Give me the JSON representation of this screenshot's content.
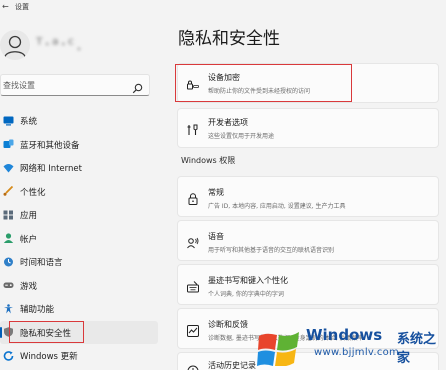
{
  "window": {
    "title": "设置"
  },
  "user": {
    "name": "ᵀ·ᵃ·ᶜ."
  },
  "search": {
    "placeholder": "查找设置"
  },
  "sidebar": {
    "items": [
      {
        "label": "系统",
        "icon": "monitor-icon",
        "color": "#0067c0"
      },
      {
        "label": "蓝牙和其他设备",
        "icon": "bluetooth-icon",
        "color": "#0b7fd4"
      },
      {
        "label": "网络和 Internet",
        "icon": "wifi-icon",
        "color": "#1f86d9"
      },
      {
        "label": "个性化",
        "icon": "brush-icon",
        "color": "#d68a1a"
      },
      {
        "label": "应用",
        "icon": "apps-icon",
        "color": "#5a6a7a"
      },
      {
        "label": "帐户",
        "icon": "account-icon",
        "color": "#2a9d6a"
      },
      {
        "label": "时间和语言",
        "icon": "globe-clock-icon",
        "color": "#2f7fc8"
      },
      {
        "label": "游戏",
        "icon": "gamepad-icon",
        "color": "#6a6a6a"
      },
      {
        "label": "辅助功能",
        "icon": "accessibility-icon",
        "color": "#1c6fc0"
      },
      {
        "label": "隐私和安全性",
        "icon": "shield-icon",
        "color": "#7a7a7a",
        "active": true
      },
      {
        "label": "Windows 更新",
        "icon": "update-icon",
        "color": "#0a74d0"
      }
    ]
  },
  "main": {
    "title": "隐私和安全性",
    "section_windows_perm": "Windows 权限",
    "cards": {
      "device_encryption": {
        "title": "设备加密",
        "desc": "帮助防止你的文件受到未经授权的访问"
      },
      "developer": {
        "title": "开发者选项",
        "desc": "这些设置仅用于开发用途"
      },
      "general": {
        "title": "常规",
        "desc": "广告 ID, 本地内容, 应用启动, 设置建议, 生产力工具"
      },
      "speech": {
        "title": "语音",
        "desc": "用于听写和其他基于语音的交互的联机语音识别"
      },
      "inking": {
        "title": "墨迹书写和键入个性化",
        "desc": "个人词典, 你的字典中的字词"
      },
      "diagnostics": {
        "title": "诊断和反馈",
        "desc": "诊断数据, 墨迹书写和键入数据, 量身定制的体验, 反馈频率"
      },
      "activity": {
        "title": "活动历史记录"
      }
    }
  },
  "watermark": {
    "text": "Windows",
    "cn": "系统之家",
    "url": "www.bjjmlv.com"
  }
}
